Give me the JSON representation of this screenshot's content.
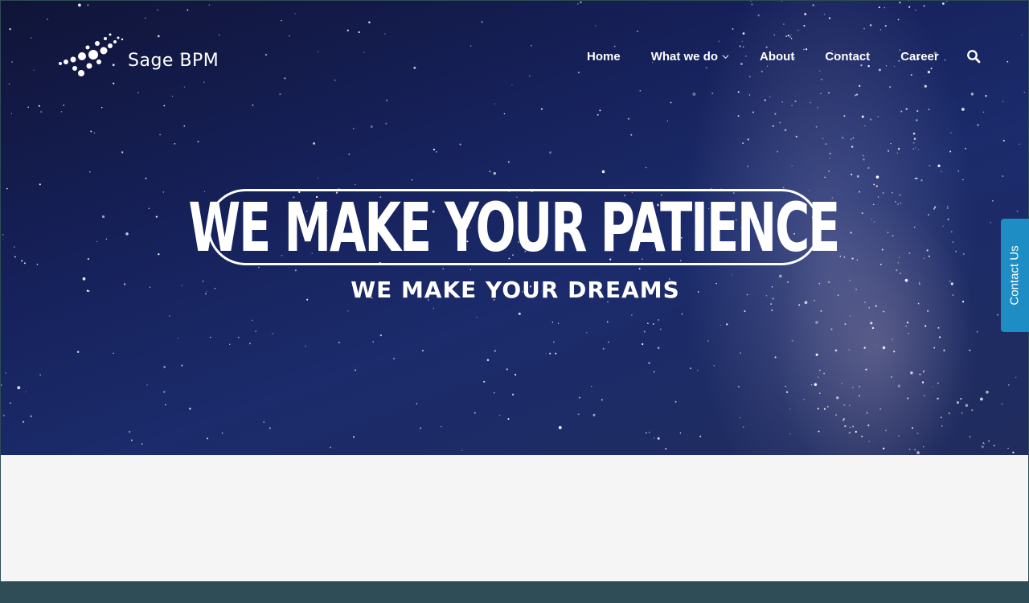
{
  "brand": {
    "name": "Sage BPM",
    "logo_icon": "dot-swoosh-logo-icon"
  },
  "nav": {
    "items": [
      {
        "label": "Home"
      },
      {
        "label": "What we do",
        "has_dropdown": true
      },
      {
        "label": "About"
      },
      {
        "label": "Contact"
      },
      {
        "label": "Career"
      }
    ],
    "search_icon": "search-icon"
  },
  "hero": {
    "headline": "WE MAKE YOUR PATIENCE",
    "subheadline": "WE MAKE YOUR DREAMS",
    "background": "starry-night-sky"
  },
  "contact_tab": {
    "label": "Contact Us"
  },
  "colors": {
    "hero_sky": "#16215a",
    "contact_tab": "#1e8dc4",
    "page_bg": "#f5f5f5",
    "footer_strip": "#2f4d57"
  }
}
